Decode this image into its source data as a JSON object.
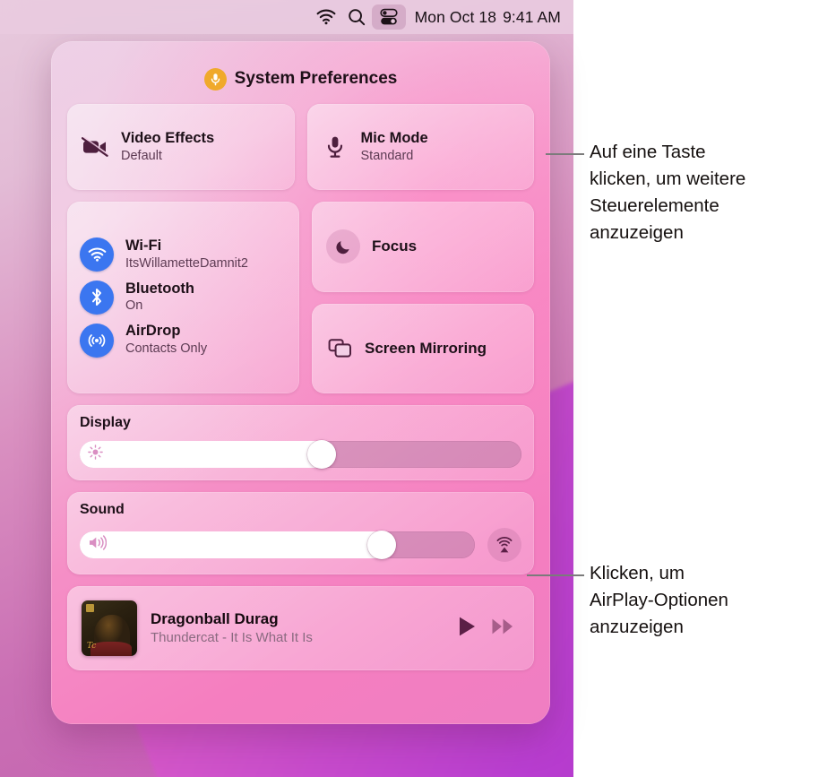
{
  "menubar": {
    "icons": [
      {
        "name": "wifi-icon",
        "label": "Wi-Fi"
      },
      {
        "name": "search-icon",
        "label": "Spotlight"
      },
      {
        "name": "control-center-icon",
        "label": "Control Center"
      }
    ],
    "date": "Mon Oct 18",
    "time": "9:41 AM"
  },
  "control_center": {
    "title": "System Preferences",
    "title_badge_icon": "microphone-icon",
    "tiles_top": [
      {
        "icon": "video-camera-slash-icon",
        "title": "Video Effects",
        "subtitle": "Default"
      },
      {
        "icon": "microphone-icon",
        "title": "Mic Mode",
        "subtitle": "Standard"
      }
    ],
    "connectivity": [
      {
        "icon": "wifi-icon",
        "title": "Wi-Fi",
        "subtitle": "ItsWillametteDamnit2"
      },
      {
        "icon": "bluetooth-icon",
        "title": "Bluetooth",
        "subtitle": "On"
      },
      {
        "icon": "airdrop-icon",
        "title": "AirDrop",
        "subtitle": "Contacts Only"
      }
    ],
    "focus": {
      "icon": "moon-icon",
      "label": "Focus"
    },
    "screen_mirroring": {
      "icon": "screen-mirroring-icon",
      "label": "Screen Mirroring"
    },
    "display": {
      "label": "Display",
      "icon": "brightness-sun-icon",
      "value_percent": 58
    },
    "sound": {
      "label": "Sound",
      "icon": "speaker-waves-icon",
      "value_percent": 80,
      "airplay_icon": "airplay-audio-icon"
    },
    "now_playing": {
      "track": "Dragonball Durag",
      "artist_album": "Thundercat - It Is What It Is",
      "album_art_name": "album-artwork",
      "play_icon": "play-icon",
      "forward_icon": "fast-forward-icon"
    }
  },
  "callouts": [
    {
      "name": "callout-buttons",
      "text": "Auf eine Taste\nklicken, um weitere\nSteuerelemente\nanzuzeigen"
    },
    {
      "name": "callout-airplay",
      "text": "Klicken, um\nAirPlay-Optionen\nanzuzeigen"
    }
  ],
  "colors": {
    "accent_blue": "#3b76f0",
    "badge_orange": "#f0a92b",
    "icon_purple": "#4e1f3e",
    "callout_line": "#7b7b7b"
  }
}
